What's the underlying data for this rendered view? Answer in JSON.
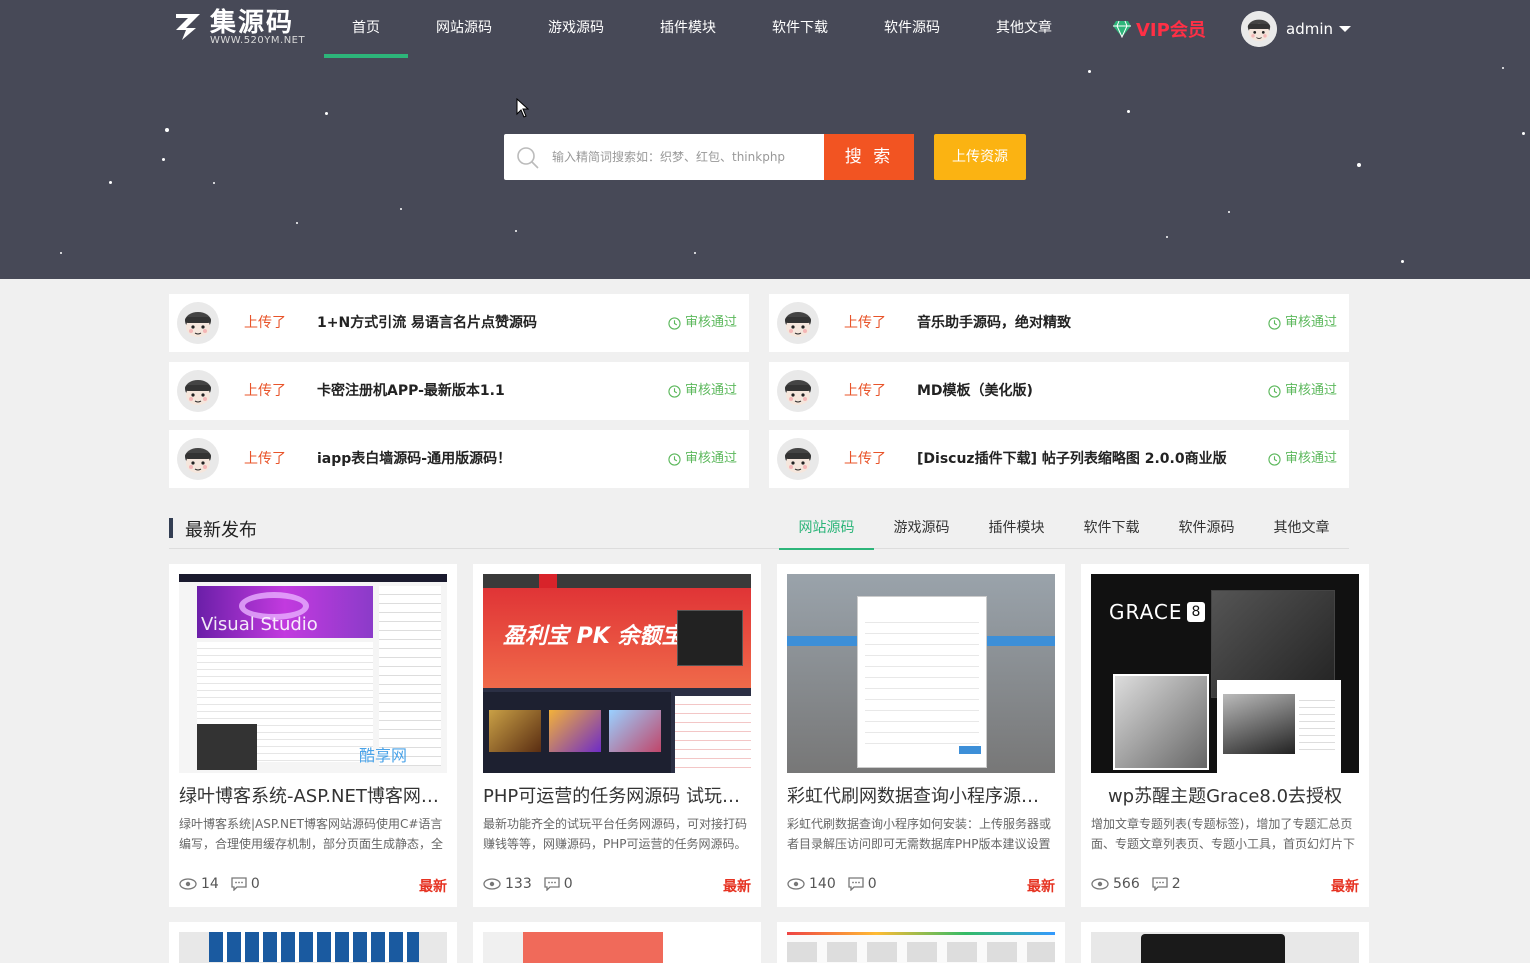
{
  "logo": {
    "text": "集源码",
    "sub": "WWW.520YM.NET"
  },
  "nav": {
    "items": [
      {
        "label": "首页",
        "active": true
      },
      {
        "label": "网站源码"
      },
      {
        "label": "游戏源码"
      },
      {
        "label": "插件模块"
      },
      {
        "label": "软件下载"
      },
      {
        "label": "软件源码"
      },
      {
        "label": "其他文章"
      }
    ],
    "vip_label": "VIP会员",
    "user_name": "admin"
  },
  "search": {
    "placeholder": "输入精简词搜索如：织梦、红包、thinkphp",
    "button_label": "搜 索",
    "upload_label": "上传资源"
  },
  "uploads": [
    {
      "action": "上传了",
      "title": "1+N方式引流 易语言名片点赞源码",
      "status": "审核通过"
    },
    {
      "action": "上传了",
      "title": "音乐助手源码，绝对精致",
      "status": "审核通过"
    },
    {
      "action": "上传了",
      "title": "卡密注册机APP-最新版本1.1",
      "status": "审核通过"
    },
    {
      "action": "上传了",
      "title": "MD模板（美化版)",
      "status": "审核通过"
    },
    {
      "action": "上传了",
      "title": "iapp表白墙源码-通用版源码！",
      "status": "审核通过"
    },
    {
      "action": "上传了",
      "title": "[Discuz插件下载] 帖子列表缩略图 2.0.0商业版",
      "status": "审核通过"
    }
  ],
  "section": {
    "title": "最新发布",
    "tabs": [
      "网站源码",
      "游戏源码",
      "插件模块",
      "软件下载",
      "软件源码",
      "其他文章"
    ]
  },
  "cards": [
    {
      "title": "绿叶博客系统-ASP.NET博客网站源码",
      "desc": "绿叶博客系统|ASP.NET博客网站源码使用C#语言编写，合理使用缓存机制，部分页面生成静态，全",
      "views": "14",
      "comments": "0",
      "badge": "最新",
      "thumb_text": "Visual Studio",
      "watermark": "酷享网"
    },
    {
      "title": "PHP可运营的任务网源码 试玩平台",
      "desc": "最新功能齐全的试玩平台任务网源码，可对接打码赚钱等等，网赚源码，PHP可运营的任务网源码。",
      "views": "133",
      "comments": "0",
      "badge": "最新",
      "thumb_text": "盈利宝 PK 余额宝"
    },
    {
      "title": "彩虹代刷网数据查询小程序源码分享",
      "desc": "彩虹代刷数据查询小程序如何安装：上传服务器或者目录解压访问即可无需数据库PHP版本建议设置",
      "views": "140",
      "comments": "0",
      "badge": "最新"
    },
    {
      "title": "wp苏醒主题Grace8.0去授权",
      "desc": "增加文章专题列表(专题标签)，增加了专题汇总页面、专题文章列表页、专题小工具，首页幻灯片下",
      "views": "566",
      "comments": "2",
      "badge": "最新",
      "thumb_text": "GRACE",
      "thumb_num": "8"
    }
  ],
  "colors": {
    "nav_bg": "#474957",
    "accent_green": "#2db57a",
    "search_btn": "#f25422",
    "upload_btn": "#fbb312",
    "vip": "#ff2f45"
  }
}
